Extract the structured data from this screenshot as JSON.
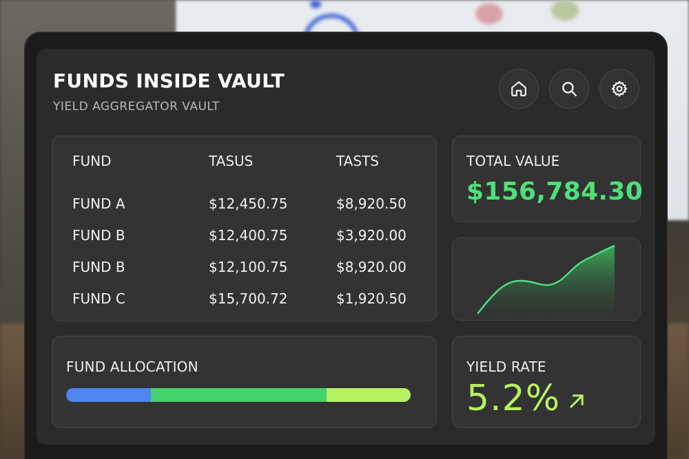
{
  "header": {
    "title": "FUNDS INSIDE VAULT",
    "subtitle": "YIELD AGGREGATOR VAULT"
  },
  "toolbar": {
    "icons": [
      "home-icon",
      "search-icon",
      "gear-icon"
    ]
  },
  "table": {
    "columns": [
      "FUND",
      "TASUS",
      "TASTS"
    ],
    "rows": [
      {
        "fund": "FUND A",
        "tasus": "$12,450.75",
        "tasts": "$8,920.50"
      },
      {
        "fund": "FUND B",
        "tasus": "$12,400.75",
        "tasts": "$3,920.00"
      },
      {
        "fund": "FUND B",
        "tasus": "$12,100.75",
        "tasts": "$8,920.00"
      },
      {
        "fund": "FUND C",
        "tasus": "$15,700.72",
        "tasts": "$1,920.50"
      }
    ]
  },
  "total": {
    "label": "TOTAL VALUE",
    "value": "$156,784.30"
  },
  "allocation": {
    "label": "FUND ALLOCATION",
    "segments": [
      {
        "fraction": 0.245,
        "color": "#4f86f0"
      },
      {
        "fraction": 0.51,
        "color": "#46d26c"
      },
      {
        "fraction": 0.245,
        "color": "#b6f163"
      }
    ]
  },
  "yield": {
    "label": "YIELD RATE",
    "value": "5.2%"
  },
  "colors": {
    "accent_green": "#4ee07a",
    "accent_lime": "#b6f163",
    "card_bg": "#333333",
    "screen_bg": "#2b2b2b"
  }
}
